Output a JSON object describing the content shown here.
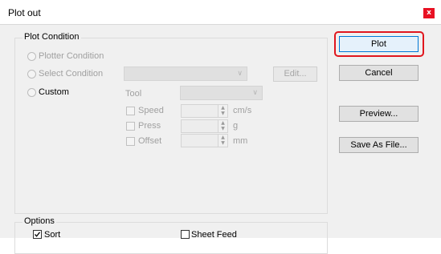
{
  "window": {
    "title": "Plot out",
    "close_glyph": "x"
  },
  "plot_condition": {
    "legend": "Plot Condition",
    "radios": [
      {
        "label": "Plotter Condition",
        "enabled": false
      },
      {
        "label": "Select Condition",
        "enabled": false
      },
      {
        "label": "Custom",
        "enabled": true
      }
    ],
    "edit_button": "Edit...",
    "tool_label": "Tool",
    "params": [
      {
        "label": "Speed",
        "unit": "cm/s"
      },
      {
        "label": "Press",
        "unit": "g"
      },
      {
        "label": "Offset",
        "unit": "mm"
      }
    ]
  },
  "options": {
    "legend": "Options",
    "sort": {
      "label": "Sort",
      "checked": true
    },
    "sheet_feed": {
      "label": "Sheet Feed",
      "checked": false
    }
  },
  "buttons": {
    "plot": "Plot",
    "cancel": "Cancel",
    "preview": "Preview...",
    "save_as_file": "Save As File..."
  },
  "colors": {
    "highlight": "#e0161e",
    "default_border": "#0078d7",
    "close_bg": "#e81123"
  },
  "icons": {
    "spin_up": "▲",
    "spin_down": "▼",
    "combo": "chevron-down-icon",
    "check": "✓"
  }
}
